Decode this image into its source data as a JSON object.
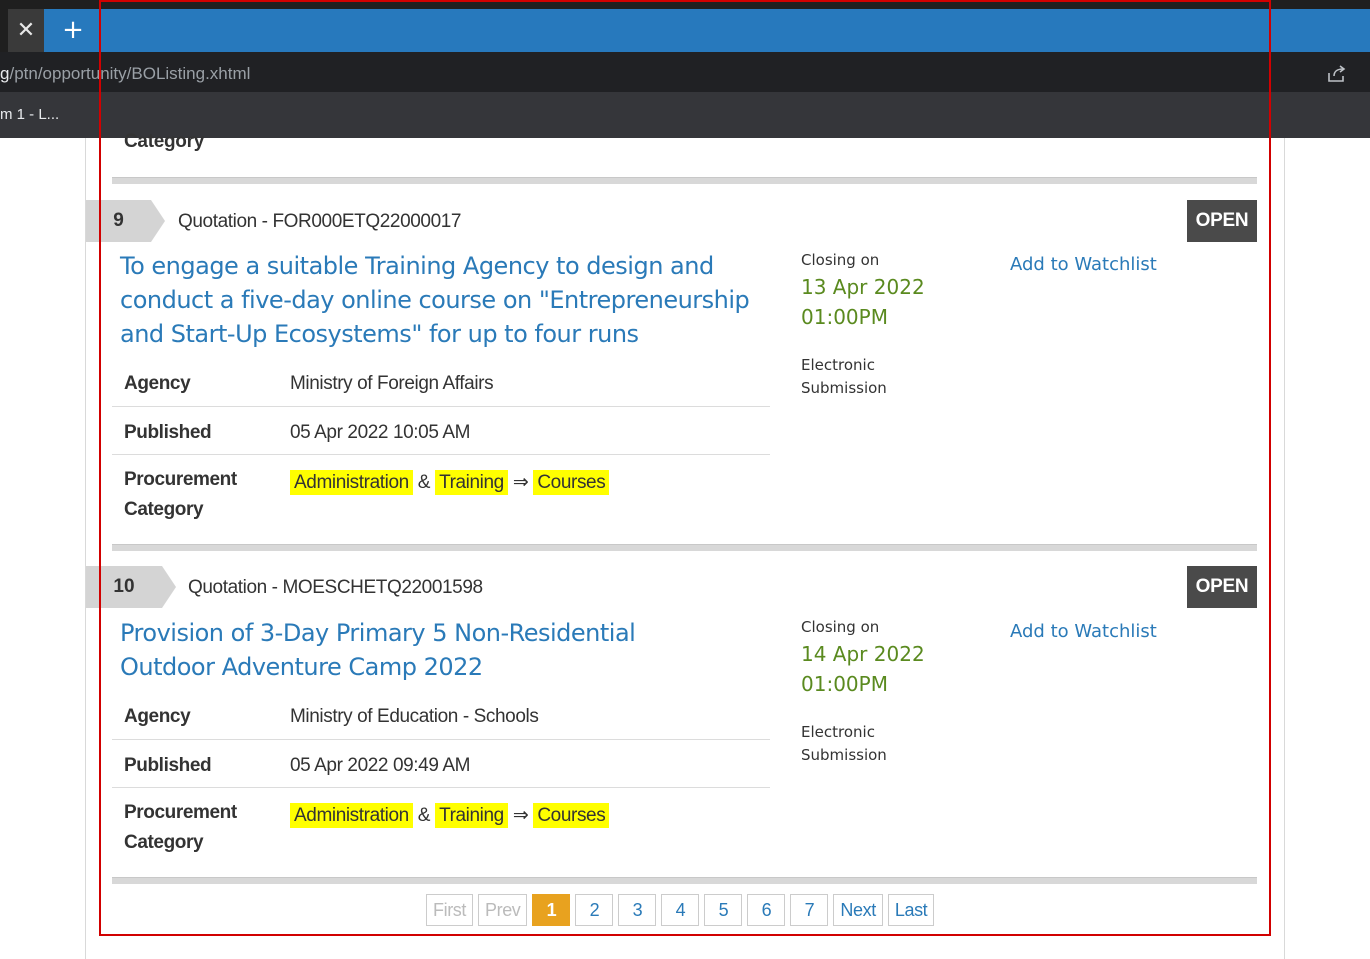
{
  "browser": {
    "tab_close_glyph": "✕",
    "new_tab_glyph": "+",
    "url_prefix": "g",
    "url_rest": "/ptn/opportunity/BOListing.xhtml",
    "bookmark": "m 1 - L..."
  },
  "previous_entry": {
    "category_label": "Category"
  },
  "listings": [
    {
      "number": "9",
      "reference": "Quotation - FOR000ETQ22000017",
      "status": "OPEN",
      "title": "To engage a suitable Training Agency to design and conduct a five-day online course on \"Entrepreneurship and Start-Up Ecosystems\" for up to four runs",
      "closing_label": "Closing on",
      "closing_date": "13 Apr 2022",
      "closing_time": "01:00PM",
      "submission": "Electronic Submission",
      "watch_label": "Add to Watchlist",
      "agency_label": "Agency",
      "agency": "Ministry of Foreign Affairs",
      "published_label": "Published",
      "published": "05 Apr 2022 10:05 AM",
      "category_label_1": "Procurement",
      "category_label_2": "Category",
      "category_1": "Administration",
      "amp": "&",
      "category_2": "Training",
      "arrow": "⇒",
      "category_3": "Courses"
    },
    {
      "number": "10",
      "reference": "Quotation - MOESCHETQ22001598",
      "status": "OPEN",
      "title": "Provision of 3-Day Primary 5 Non-Residential Outdoor Adventure Camp 2022",
      "closing_label": "Closing on",
      "closing_date": "14 Apr 2022",
      "closing_time": "01:00PM",
      "submission": "Electronic Submission",
      "watch_label": "Add to Watchlist",
      "agency_label": "Agency",
      "agency": "Ministry of Education - Schools",
      "published_label": "Published",
      "published": "05 Apr 2022 09:49 AM",
      "category_label_1": "Procurement",
      "category_label_2": "Category",
      "category_1": "Administration",
      "amp": "&",
      "category_2": "Training",
      "arrow": "⇒",
      "category_3": "Courses"
    }
  ],
  "pagination": {
    "first": "First",
    "prev": "Prev",
    "pages": [
      "1",
      "2",
      "3",
      "4",
      "5",
      "6",
      "7"
    ],
    "current": "1",
    "next": "Next",
    "last": "Last"
  },
  "colors": {
    "tab_strip": "#2779bd",
    "link": "#2a7ab8",
    "closing_date": "#5a8a1f",
    "highlight": "#ffff00",
    "active_page": "#e8a21f",
    "status_badge": "#4a4a4a"
  }
}
